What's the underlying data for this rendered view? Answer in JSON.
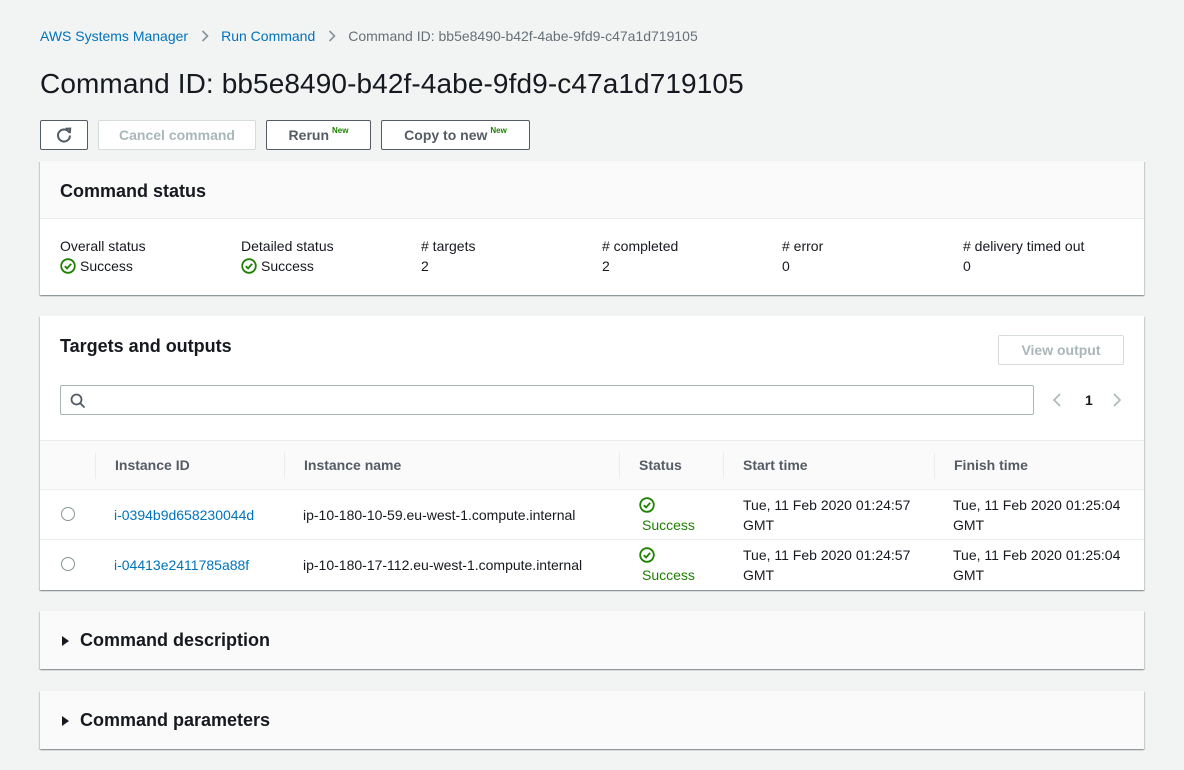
{
  "breadcrumb": {
    "items": [
      "AWS Systems Manager",
      "Run Command"
    ],
    "current": "Command ID: bb5e8490-b42f-4abe-9fd9-c47a1d719105"
  },
  "page": {
    "title": "Command ID: bb5e8490-b42f-4abe-9fd9-c47a1d719105"
  },
  "actions": {
    "refresh_icon": "refresh-icon",
    "cancel_label": "Cancel command",
    "rerun_label": "Rerun",
    "copy_label": "Copy to new",
    "new_badge": "New"
  },
  "command_status": {
    "title": "Command status",
    "columns": [
      {
        "label": "Overall status",
        "value": "Success",
        "kind": "success"
      },
      {
        "label": "Detailed status",
        "value": "Success",
        "kind": "success"
      },
      {
        "label": "# targets",
        "value": "2",
        "kind": "plain"
      },
      {
        "label": "# completed",
        "value": "2",
        "kind": "plain"
      },
      {
        "label": "# error",
        "value": "0",
        "kind": "plain"
      },
      {
        "label": "# delivery timed out",
        "value": "0",
        "kind": "plain"
      }
    ]
  },
  "targets": {
    "title": "Targets and outputs",
    "view_output_label": "View output",
    "search_placeholder": "",
    "page": "1",
    "columns": [
      "Instance ID",
      "Instance name",
      "Status",
      "Start time",
      "Finish time"
    ],
    "rows": [
      {
        "instance_id": "i-0394b9d658230044d",
        "instance_name": "ip-10-180-10-59.eu-west-1.compute.internal",
        "status": "Success",
        "start_line1": "Tue, 11 Feb 2020 01:24:57",
        "start_line2": "GMT",
        "finish_line1": "Tue, 11 Feb 2020 01:25:04",
        "finish_line2": "GMT"
      },
      {
        "instance_id": "i-04413e2411785a88f",
        "instance_name": "ip-10-180-17-112.eu-west-1.compute.internal",
        "status": "Success",
        "start_line1": "Tue, 11 Feb 2020 01:24:57",
        "start_line2": "GMT",
        "finish_line1": "Tue, 11 Feb 2020 01:25:04",
        "finish_line2": "GMT"
      }
    ]
  },
  "sections": {
    "description_title": "Command description",
    "parameters_title": "Command parameters"
  },
  "colors": {
    "link": "#0073bb",
    "success": "#1d8102",
    "background": "#f2f3f3"
  }
}
